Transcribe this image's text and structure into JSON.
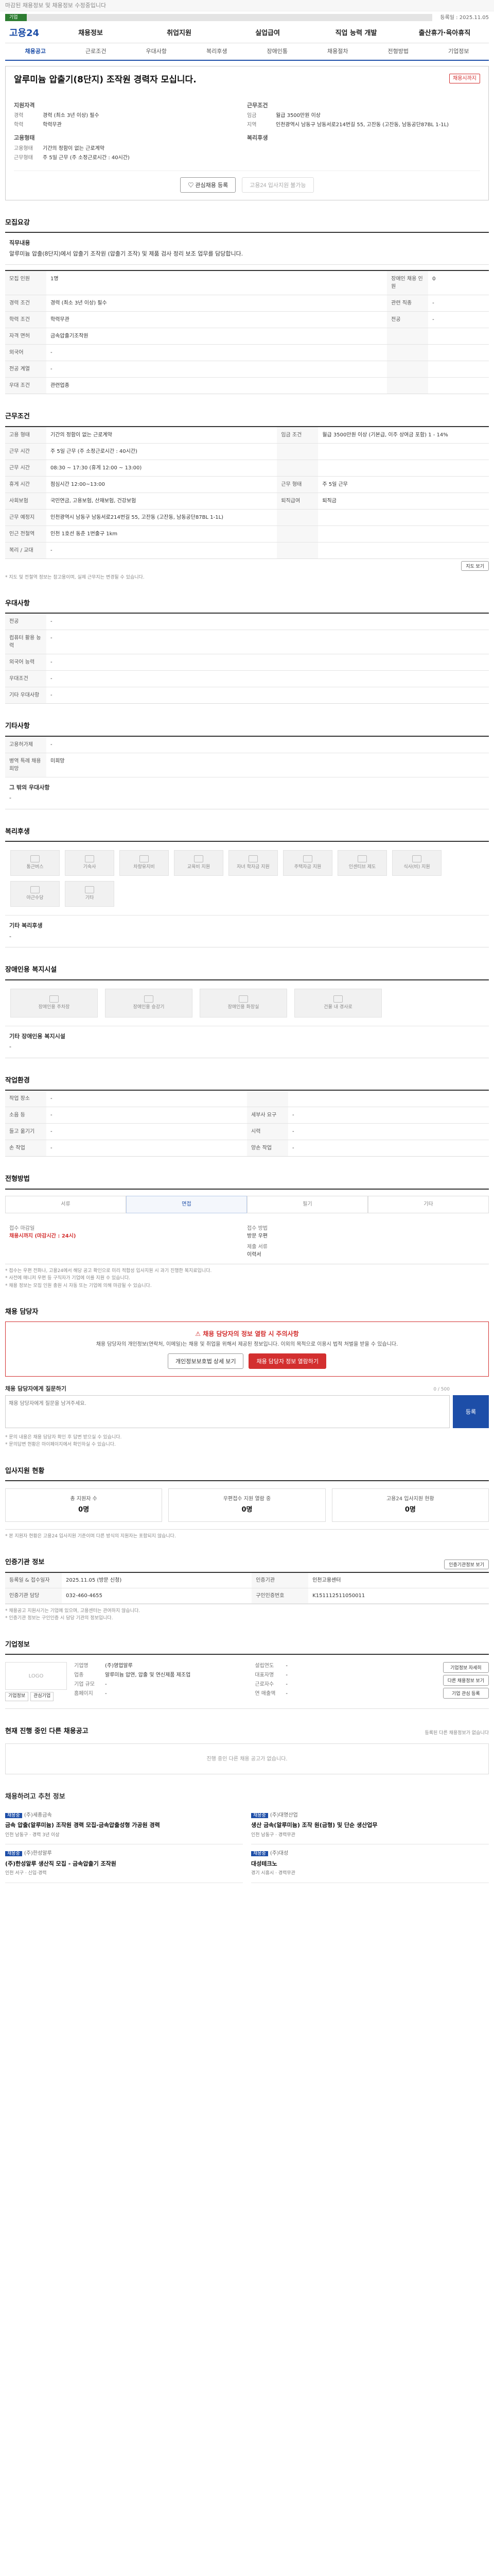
{
  "top_note": "마감된 채용정보 및 채용정보 수정중입니다",
  "progress": {
    "value": 0.05,
    "label": "기업",
    "side": "등록일 : 2025.11.05"
  },
  "header": {
    "logo": "고용24",
    "gnb": [
      "채용정보",
      "취업지원",
      "실업급여",
      "직업 능력 개발",
      "출산휴가·육아휴직"
    ]
  },
  "subnav": [
    "채용공고",
    "근로조건",
    "우대사항",
    "복리후생",
    "장애인통",
    "채용절차",
    "전형방법",
    "기업정보"
  ],
  "job": {
    "badge": "채용시까지",
    "title": "알루미늄 압출기(8단지) 조작원 경력자 모십니다.",
    "company": "",
    "left_head": "지원자격",
    "left": [
      {
        "k": "경력",
        "v": "경력 (최소 3년 이상) 필수"
      },
      {
        "k": "학력",
        "v": "학력무관"
      }
    ],
    "left_head2": "고용형태",
    "left2": [
      {
        "k": "고용형태",
        "v": "기간의 정함이 없는 근로계약"
      },
      {
        "k": "근무형태",
        "v": "주 5일 근무 (주 소정근로시간 : 40시간)"
      }
    ],
    "right_head": "근무조건",
    "right": [
      {
        "k": "임금",
        "v": "월급 3500만원 이상"
      },
      {
        "k": "지역",
        "v": "인천광역시 남동구 남동서로214번길 55, 고잔동 (고잔동, 남동공단87BL 1-1L)"
      }
    ],
    "right_head2": "복리후생",
    "right2": [],
    "btn_save": "관심채용 등록",
    "btn_apply": "고용24 입사지원 불가능"
  },
  "sec_recruit": {
    "title": "모집요강",
    "content_head": "직무내용",
    "content": "알루미늄 압출(8단지)에서 압출기 조작원 (압출기 조작) 및 제품 검사 정리 보조 업무를 담당합니다.",
    "rows": [
      [
        {
          "k": "모집 인원",
          "v": "1명"
        },
        {
          "k": "장애인 채용 인원",
          "v": "0"
        }
      ],
      [
        {
          "k": "경력 조건",
          "v": "경력 (최소 3년 이상) 필수"
        },
        {
          "k": "관련 직종",
          "v": "-"
        }
      ],
      [
        {
          "k": "학력 조건",
          "v": "학력무관"
        },
        {
          "k": "전공",
          "v": "-"
        }
      ],
      [
        {
          "k": "자격 면허",
          "v": "금속압출기조작원"
        },
        {
          "k": "",
          "v": ""
        }
      ],
      [
        {
          "k": "외국어",
          "v": "-"
        },
        {
          "k": "",
          "v": ""
        }
      ],
      [
        {
          "k": "전공 계열",
          "v": "-"
        },
        {
          "k": "",
          "v": ""
        }
      ],
      [
        {
          "k": "우대 조건",
          "v": "관련업종"
        },
        {
          "k": "",
          "v": ""
        }
      ]
    ]
  },
  "sec_cond": {
    "title": "근무조건",
    "rows": [
      [
        {
          "k": "고용 형태",
          "v": "기간의 정함이 없는 근로계약"
        },
        {
          "k": "임금 조건",
          "v": "월급 3500만원 이상 (기본급, 이주 상여금 포함) 1 - 14%"
        }
      ],
      [
        {
          "k": "근무 시간",
          "v": "주 5일 근무 (주 소정근로시간 : 40시간)"
        },
        {
          "k": "",
          "v": ""
        }
      ],
      [
        {
          "k": "근무 시간",
          "v": "08:30 ~ 17:30 (휴게 12:00 ~ 13:00)"
        },
        {
          "k": "",
          "v": ""
        }
      ],
      [
        {
          "k": "휴게 시간",
          "v": "점심시간 12:00~13:00"
        },
        {
          "k": "근무 형태",
          "v": "주 5일 근무"
        }
      ],
      [
        {
          "k": "사회보험",
          "v": "국민연금, 고용보험, 산재보험, 건강보험"
        },
        {
          "k": "퇴직급여",
          "v": "퇴직금"
        }
      ],
      [
        {
          "k": "근무 예정지",
          "v": "인천광역시 남동구 남동서로214번길 55, 고잔동 (고잔동, 남동공단87BL 1-1L)"
        },
        {
          "k": "",
          "v": ""
        }
      ],
      [
        {
          "k": "인근 전철역",
          "v": "인천 1호선 동춘 1번출구 1km"
        },
        {
          "k": "",
          "v": ""
        }
      ],
      [
        {
          "k": "복리 / 교대",
          "v": "-"
        },
        {
          "k": "",
          "v": ""
        }
      ]
    ],
    "map_btn": "지도 보기",
    "note": "* 지도 및 전철역 정보는 참고용이며, 실제 근무지는 변경될 수 있습니다."
  },
  "sec_pref": {
    "title": "우대사항",
    "rows": [
      {
        "k": "전공",
        "v": "-"
      },
      {
        "k": "컴퓨터 활용 능력",
        "v": "-"
      },
      {
        "k": "외국어 능력",
        "v": "-"
      },
      {
        "k": "우대조건",
        "v": "-"
      },
      {
        "k": "기타 우대사항",
        "v": "-"
      }
    ]
  },
  "sec_etc": {
    "title": "기타사항",
    "rows": [
      {
        "k": "고용허가제",
        "v": "-"
      },
      {
        "k": "병역 특례 채용 희망",
        "v": "미희망"
      }
    ],
    "extra_head": "그 밖의 우대사항",
    "extra": "-"
  },
  "sec_welfare": {
    "title": "복리후생",
    "tiles": [
      "통근버스",
      "기숙사",
      "차량유지비",
      "교육비 지원",
      "자녀 학자금 지원",
      "주택자금 지원",
      "인센티브 제도",
      "식사(비) 지원",
      "야근수당",
      "기타"
    ],
    "extra_head": "기타 복리후생",
    "extra": "-"
  },
  "sec_disab": {
    "title": "장애인용 복지시설",
    "tiles": [
      "장애인용 주차장",
      "장애인용 승강기",
      "장애인용 화장실",
      "건물 내 경사로"
    ],
    "extra_head": "기타 장애인용 복지시설",
    "extra": "-"
  },
  "sec_env": {
    "title": "작업환경",
    "rows": [
      [
        {
          "k": "작업 장소",
          "v": "-"
        },
        {
          "k": "",
          "v": ""
        }
      ],
      [
        {
          "k": "소음 등",
          "v": "-"
        },
        {
          "k": "세부사 요구",
          "v": "-"
        }
      ],
      [
        {
          "k": "들고 옮기기",
          "v": "-"
        },
        {
          "k": "시력",
          "v": "-"
        }
      ],
      [
        {
          "k": "손 작업",
          "v": "-"
        },
        {
          "k": "양손 작업",
          "v": "-"
        }
      ]
    ]
  },
  "sec_process": {
    "title": "전형방법",
    "steps": [
      "서류",
      "면접",
      "필기",
      "기타"
    ],
    "d1_lbl": "접수 마감일",
    "d1_val": "채용시까지 (마감시간 : 24시)",
    "d2_lbl": "접수 방법",
    "d2_val": "방문 우편",
    "d3_lbl": "제출 서류",
    "d3_val": "이력서",
    "notes": [
      "* 접수는 우편 전화나, 고용24에서 해당 공고 확인으로 미리 적합성 입사지원 시 과기 진행한 복지료입니다.",
      "* 사전에 매니저 우편 등 구직자가 기업에 이를 지원 수 있습니다.",
      "* 채용 정보는 모집 인원 충원 시 자동 또는 기업에 의해 마감될 수 있습니다."
    ]
  },
  "sec_contact": {
    "title": "채용 담당자",
    "notice_title": "채용 담당자의 정보 열람 시 주의사항",
    "notice_text": "채용 담당자의 개인정보(연락처, 이메일)는 채용 및 취업을 위해서 제공된 정보입니다. 이외의 목적으로 이용시 법적 처벌을 받을 수 있습니다.",
    "btn_left": "개인정보보호법 상세 보기",
    "btn_right": "채용 담당자 정보 열람하기",
    "inq_label": "채용 담당자에게 질문하기",
    "inq_placeholder": "채용 담당자에게 질문을 남겨주세요.",
    "inq_count": "0 / 500",
    "inq_submit": "등록",
    "notes": [
      "* 문의 내용은 채용 담당자 확인 후 답변 받으실 수 있습니다.",
      "* 문의답변 현황은 마이페이지에서 확인하실 수 있습니다."
    ]
  },
  "sec_status": {
    "title": "입사지원 현황",
    "stats": [
      {
        "l": "총 지원자 수",
        "v": "0명"
      },
      {
        "l": "우편접수 지원 열람 중",
        "v": "0명"
      },
      {
        "l": "고용24 입사지원 현황",
        "v": "0명"
      }
    ],
    "note": "* 본 지원자 현황은 고용24 입사지원 기준이며 다른 방식의 지원자는 포함되지 않습니다."
  },
  "sec_org": {
    "title": "인증기관 정보",
    "btn": "인증기관정보 보기",
    "rows": [
      [
        {
          "k": "등록일 & 접수일자",
          "v": "2025.11.05 (방문 신청)"
        },
        {
          "k": "인증기관",
          "v": "인천고용센터"
        }
      ],
      [
        {
          "k": "인증기관 담당",
          "v": "032-460-4655"
        },
        {
          "k": "구인인증번호",
          "v": "K151112511050011"
        }
      ]
    ],
    "notes": [
      "* 채용공고 지원사기는 기업에 있으며, 고용센터는 관여하지 않습니다.",
      "* 인증기관 정보는 구인인증 시 담당 기관의 정보입니다."
    ]
  },
  "sec_corp": {
    "title": "기업정보",
    "logo": "LOGO",
    "mini": [
      "기업정보",
      "관심기업"
    ],
    "col1": [
      {
        "k": "기업명",
        "v": "(주)영업알루"
      },
      {
        "k": "업종",
        "v": "알루미늄 압연, 압출 및 연신제품 제조업"
      },
      {
        "k": "기업 규모",
        "v": "-"
      },
      {
        "k": "홈페이지",
        "v": "-"
      }
    ],
    "col2": [
      {
        "k": "설립연도",
        "v": "-"
      },
      {
        "k": "대표자명",
        "v": "-"
      },
      {
        "k": "근로자수",
        "v": "-"
      },
      {
        "k": "연 매출액",
        "v": "-"
      }
    ],
    "btns": [
      "기업정보 자세히",
      "다른 채용정보 보기",
      "기업 관심 등록"
    ]
  },
  "sec_other": {
    "title": "현재 진행 중인 다른 채용공고",
    "side": "등록된 다른 채용정보가 없습니다",
    "empty": "진행 중인 다른 채용 공고가 없습니다."
  },
  "sec_rec": {
    "title": "채용하려고 추천 정보",
    "cards": [
      {
        "co": "(주)세종금속",
        "tag": "채용중",
        "jt": "금속 압출(알루미늄) 조작원 경력 모집-금속압출성형 가공원 경력",
        "meta": "인천 남동구 · 경력 3년 이상"
      },
      {
        "co": "(주)대명산업",
        "tag": "채용중",
        "jt": "생산 금속(알루미늄) 조작 원(금형) 및 단순 생산업무",
        "meta": "인천 남동구 · 경력무관"
      },
      {
        "co": "(주)한성알루",
        "tag": "채용중",
        "jt": "(주)한성알루 생산직 모집 - 금속압출기 조작원",
        "meta": "인천 서구 · 신입·경력"
      },
      {
        "co": "(주)대성",
        "tag": "채용중",
        "jt": "대성테크노",
        "meta": "경기 시흥시 · 경력무관"
      }
    ]
  }
}
